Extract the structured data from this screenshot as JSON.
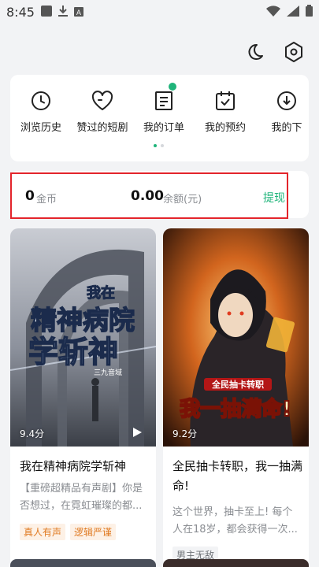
{
  "status_bar": {
    "time": "8:45"
  },
  "quick_menu": {
    "items": [
      {
        "label": "浏览历史",
        "icon": "clock-icon"
      },
      {
        "label": "赞过的短剧",
        "icon": "heart-icon"
      },
      {
        "label": "我的订单",
        "icon": "order-icon",
        "badge": true
      },
      {
        "label": "我的预约",
        "icon": "calendar-check-icon"
      },
      {
        "label": "我的下",
        "icon": "download-icon"
      }
    ]
  },
  "wallet": {
    "coins_value": "0",
    "coins_unit": "金币",
    "balance_value": "0.00",
    "balance_unit": "余额(元)",
    "withdraw_label": "提现"
  },
  "dramas": [
    {
      "poster_title_small": "我在",
      "poster_title_line1": "精神病院",
      "poster_title_line2": "学斩神",
      "poster_credit": "三九音域",
      "rating": "9.4分",
      "title": "我在精神病院学斩神",
      "desc": "【重磅超精品有声剧】你是否想过，在霓虹璀璨的都...",
      "tags": [
        "真人有声",
        "逻辑严谨"
      ]
    },
    {
      "poster_title_small": "全民抽卡转职",
      "poster_title_main": "我一抽满命!",
      "rating": "9.2分",
      "title": "全民抽卡转职，我一抽满命!",
      "desc": "这个世界，抽卡至上! 每个人在18岁，都会获得一次...",
      "tags": [
        "男主无敌"
      ]
    }
  ],
  "colors": {
    "accent": "#1fb47a",
    "highlight_border": "#e3242b"
  }
}
